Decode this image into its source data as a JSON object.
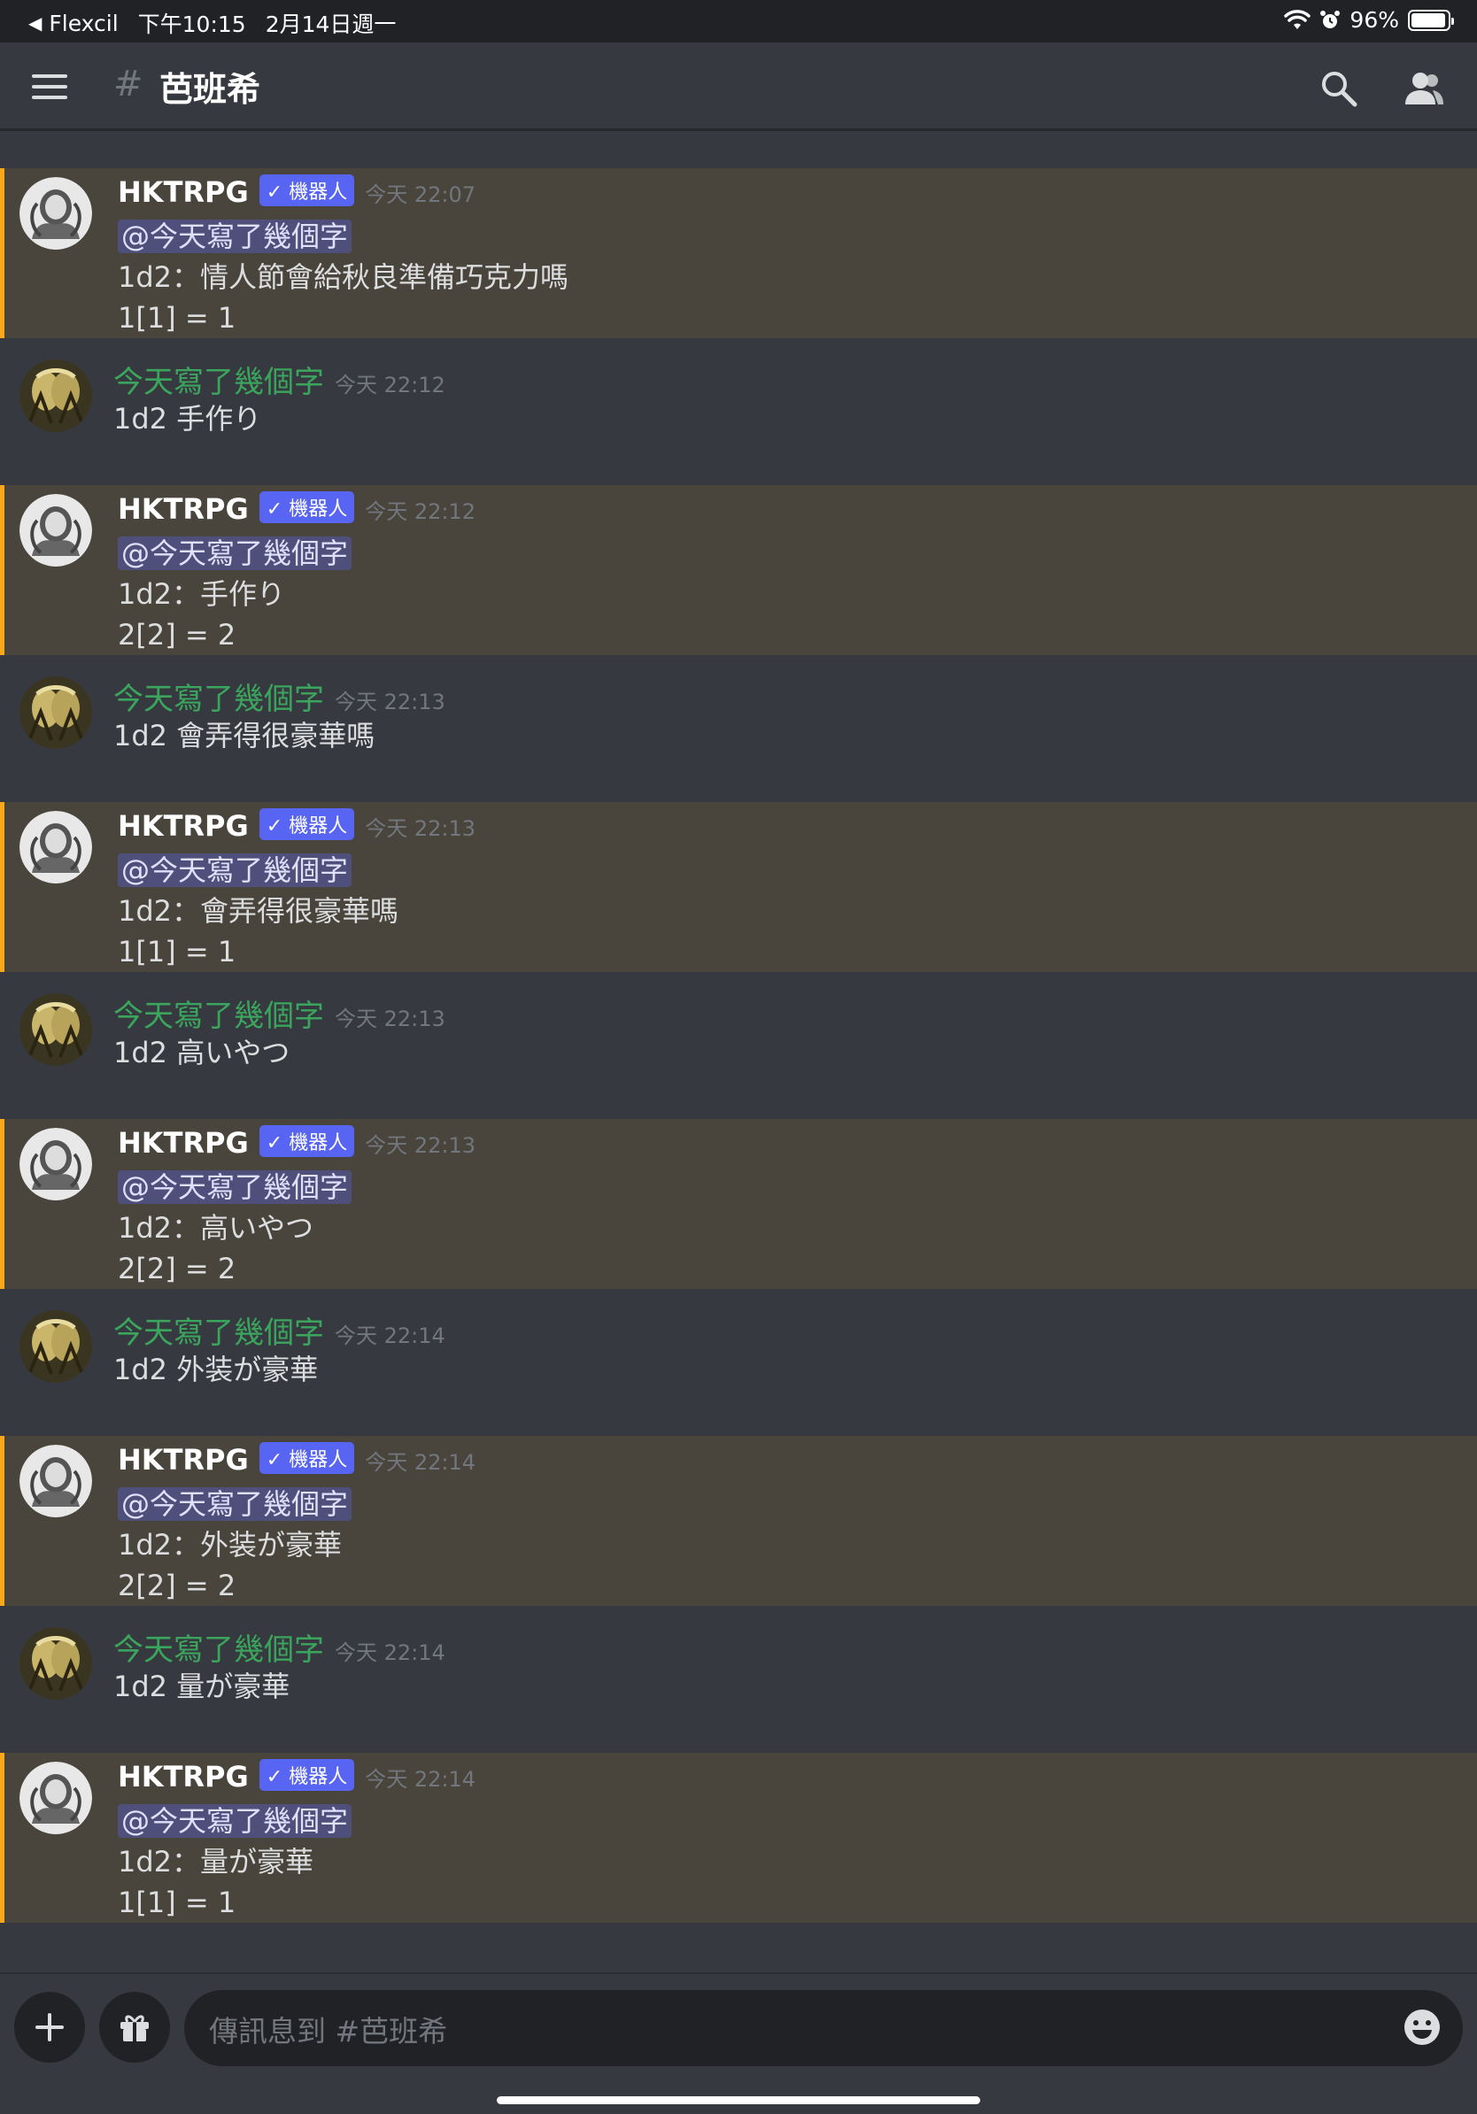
{
  "status_bar": {
    "back_app": "Flexcil",
    "time": "下午10:15",
    "date": "2月14日週一",
    "battery": "96%",
    "battery_level": 0.96
  },
  "header": {
    "channel_name": "芭班希"
  },
  "messages": [
    {
      "type": "bot",
      "username": "HKTRPG",
      "tag": "✓ 機器人",
      "timestamp": "今天 22:07",
      "mention": "@今天寫了幾個字",
      "lines": [
        "1d2：情人節會給秋良準備巧克力嗎",
        "1[1] = 1"
      ]
    },
    {
      "type": "user",
      "username": "今天寫了幾個字",
      "timestamp": "今天 22:12",
      "lines": [
        "1d2 手作り"
      ]
    },
    {
      "type": "bot",
      "username": "HKTRPG",
      "tag": "✓ 機器人",
      "timestamp": "今天 22:12",
      "mention": "@今天寫了幾個字",
      "lines": [
        "1d2：手作り",
        "2[2] = 2"
      ]
    },
    {
      "type": "user",
      "username": "今天寫了幾個字",
      "timestamp": "今天 22:13",
      "lines": [
        "1d2 會弄得很豪華嗎"
      ]
    },
    {
      "type": "bot",
      "username": "HKTRPG",
      "tag": "✓ 機器人",
      "timestamp": "今天 22:13",
      "mention": "@今天寫了幾個字",
      "lines": [
        "1d2：會弄得很豪華嗎",
        "1[1] = 1"
      ]
    },
    {
      "type": "user",
      "username": "今天寫了幾個字",
      "timestamp": "今天 22:13",
      "lines": [
        "1d2 高いやつ"
      ]
    },
    {
      "type": "bot",
      "username": "HKTRPG",
      "tag": "✓ 機器人",
      "timestamp": "今天 22:13",
      "mention": "@今天寫了幾個字",
      "lines": [
        "1d2：高いやつ",
        "2[2] = 2"
      ]
    },
    {
      "type": "user",
      "username": "今天寫了幾個字",
      "timestamp": "今天 22:14",
      "lines": [
        "1d2 外装が豪華"
      ]
    },
    {
      "type": "bot",
      "username": "HKTRPG",
      "tag": "✓ 機器人",
      "timestamp": "今天 22:14",
      "mention": "@今天寫了幾個字",
      "lines": [
        "1d2：外装が豪華",
        "2[2] = 2"
      ]
    },
    {
      "type": "user",
      "username": "今天寫了幾個字",
      "timestamp": "今天 22:14",
      "lines": [
        "1d2 量が豪華"
      ]
    },
    {
      "type": "bot",
      "username": "HKTRPG",
      "tag": "✓ 機器人",
      "timestamp": "今天 22:14",
      "mention": "@今天寫了幾個字",
      "lines": [
        "1d2：量が豪華",
        "1[1] = 1"
      ]
    }
  ],
  "composer": {
    "placeholder": "傳訊息到 #芭班希"
  },
  "colors": {
    "background": "#36393f",
    "bot_highlight": "#49443c",
    "bot_highlight_border": "#faa81a",
    "user_name": "#3ba55d",
    "bot_tag": "#5865f2"
  },
  "icons": {
    "back": "back-arrow-icon",
    "wifi": "wifi-icon",
    "alarm": "alarm-icon",
    "battery": "battery-icon",
    "menu": "hamburger-menu-icon",
    "channel": "hash-icon",
    "search": "search-icon",
    "members": "members-icon",
    "add": "plus-icon",
    "gift": "gift-icon",
    "emoji": "emoji-icon"
  }
}
